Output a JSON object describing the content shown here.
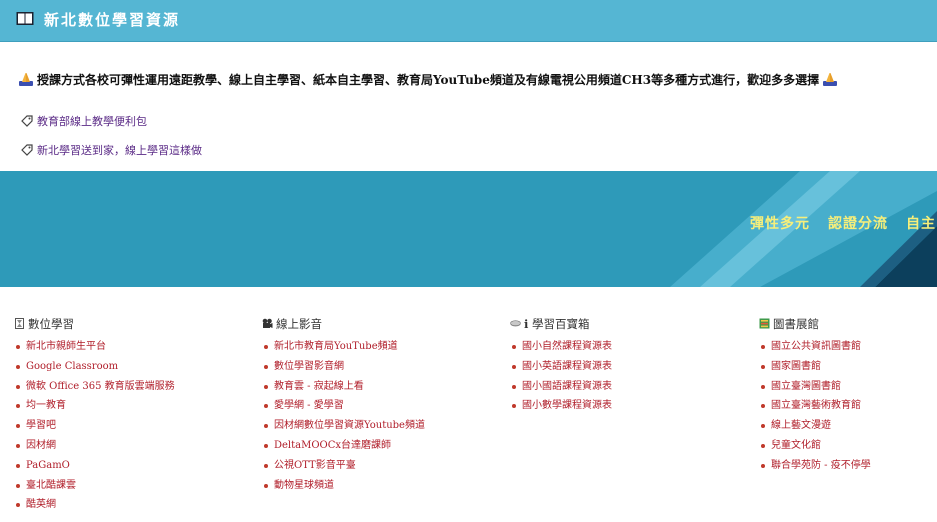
{
  "header": {
    "icon": "open-book-icon",
    "title": "新北數位學習資源"
  },
  "intro": {
    "icon": "praying-hands-icon",
    "text": "授課方式各校可彈性運用遠距教學、線上自主學習、紙本自主學習、教育局YouTube頻道及有線電視公用頻道CH3等多種方式進行，歡迎多多選擇"
  },
  "top_links": [
    {
      "icon": "label-tag-icon",
      "label": "教育部線上教學便利包"
    },
    {
      "icon": "label-tag-icon",
      "label": "新北學習送到家，線上學習這樣做"
    }
  ],
  "banner": {
    "slogans": [
      "彈性多元",
      "認證分流",
      "自主"
    ],
    "colors": {
      "base": "#2e9ab9",
      "light": "#7fd3ea",
      "dark": "#0c3f5c",
      "slogan": "#f6ef7a"
    }
  },
  "columns": [
    {
      "heading": "數位學習",
      "icon": "hourglass-icon",
      "items": [
        "新北市親師生平台",
        "Google Classroom",
        "微軟 Office 365 教育版雲端服務",
        "均一教育",
        "學習吧",
        "因材網",
        "PaGamO",
        "臺北酷課雲",
        "酷英網"
      ]
    },
    {
      "heading": "線上影音",
      "icon": "film-camera-icon",
      "items": [
        "新北市教育局YouTube頻道",
        "數位學習影音網",
        "教育雲 - 寂起線上看",
        "愛學網 - 愛學習",
        "因材網數位學習資源Youtube頻道",
        "DeltaMOOCx台達磨課師",
        "公視OTT影音平臺",
        "動物星球頻道"
      ]
    },
    {
      "heading": "ℹ 學習百寶箱",
      "icon": "disc-icon",
      "items": [
        "國小自然課程資源表",
        "國小英語課程資源表",
        "國小國語課程資源表",
        "國小數學課程資源表"
      ]
    },
    {
      "heading": "圖書展館",
      "icon": "books-icon",
      "items": [
        "國立公共資訊圖書館",
        "國家圖書館",
        "國立臺灣圖書館",
        "國立臺灣藝術教育館",
        "線上藝文漫遊",
        "兒童文化館",
        "聯合學苑防 - 疫不停學"
      ]
    }
  ]
}
